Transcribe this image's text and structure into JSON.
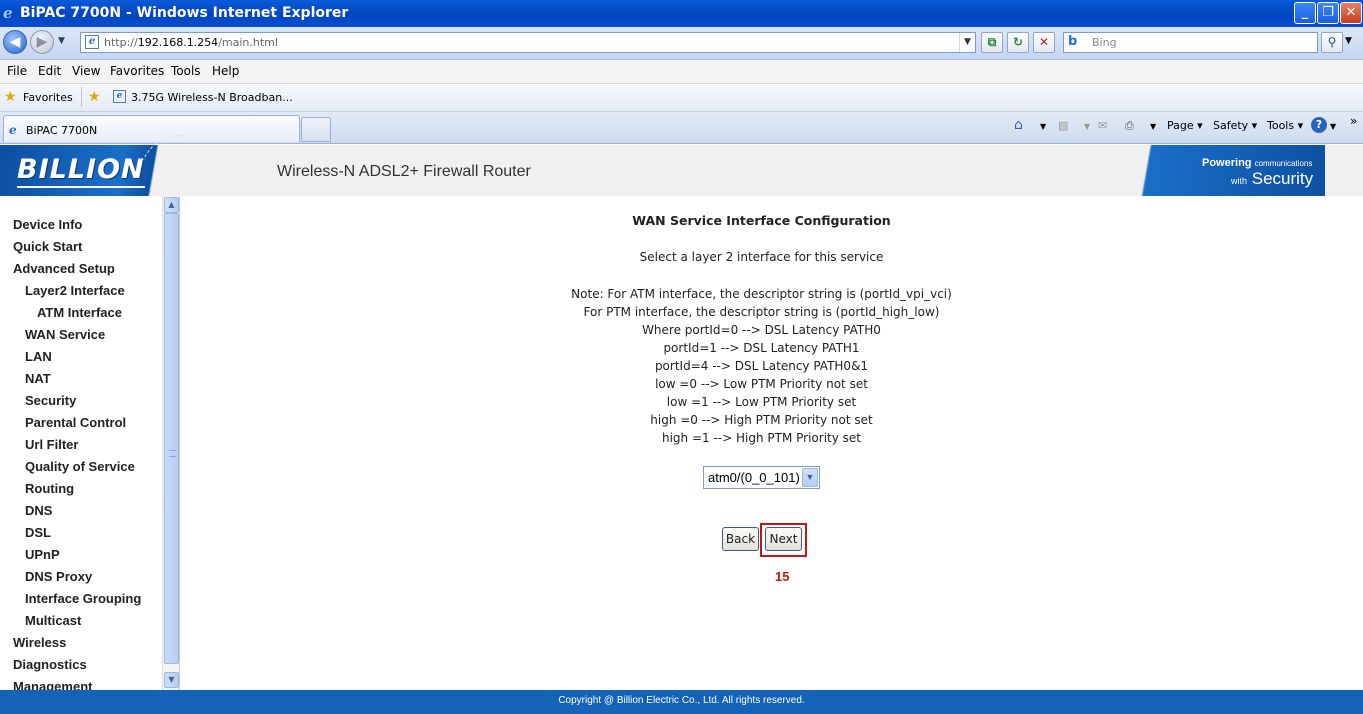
{
  "window": {
    "title": "BiPAC 7700N - Windows Internet Explorer",
    "controls": {
      "minimize": "_",
      "restore": "❐",
      "close": "✕"
    }
  },
  "address_bar": {
    "url_scheme": "http://",
    "url_host": "192.168.1.254",
    "url_path": "/main.html",
    "search_placeholder": "Bing"
  },
  "menu": [
    "File",
    "Edit",
    "View",
    "Favorites",
    "Tools",
    "Help"
  ],
  "favorites_bar": {
    "label": "Favorites",
    "link": "3.75G Wireless-N Broadban..."
  },
  "tab": {
    "title": "BiPAC 7700N"
  },
  "command_bar": {
    "page": "Page",
    "safety": "Safety",
    "tools": "Tools"
  },
  "banner": {
    "logo": "BILLION",
    "product": "Wireless-N ADSL2+ Firewall Router",
    "tagline_top": "Powering",
    "tagline_small": "communications",
    "tagline_with": "with",
    "tagline_bottom": "Security"
  },
  "sidebar": {
    "items": [
      {
        "label": "Device Info",
        "level": 0
      },
      {
        "label": "Quick Start",
        "level": 0
      },
      {
        "label": "Advanced Setup",
        "level": 0
      },
      {
        "label": "Layer2 Interface",
        "level": 1
      },
      {
        "label": "ATM Interface",
        "level": 2
      },
      {
        "label": "WAN Service",
        "level": 1
      },
      {
        "label": "LAN",
        "level": 1
      },
      {
        "label": "NAT",
        "level": 1
      },
      {
        "label": "Security",
        "level": 1
      },
      {
        "label": "Parental Control",
        "level": 1
      },
      {
        "label": "Url Filter",
        "level": 1
      },
      {
        "label": "Quality of Service",
        "level": 1
      },
      {
        "label": "Routing",
        "level": 1
      },
      {
        "label": "DNS",
        "level": 1
      },
      {
        "label": "DSL",
        "level": 1
      },
      {
        "label": "UPnP",
        "level": 1
      },
      {
        "label": "DNS Proxy",
        "level": 1
      },
      {
        "label": "Interface Grouping",
        "level": 1
      },
      {
        "label": "Multicast",
        "level": 1
      },
      {
        "label": "Wireless",
        "level": 0
      },
      {
        "label": "Diagnostics",
        "level": 0
      },
      {
        "label": "Management",
        "level": 0
      }
    ]
  },
  "main": {
    "heading": "WAN Service Interface Configuration",
    "instruction": "Select a layer 2 interface for this service",
    "notes": [
      "Note: For ATM interface, the descriptor string is (portId_vpi_vci)",
      "For PTM interface, the descriptor string is (portId_high_low)",
      "Where portId=0 --> DSL Latency PATH0",
      "portId=1 --> DSL Latency PATH1",
      "portId=4 --> DSL Latency PATH0&1",
      "low =0 --> Low PTM Priority not set",
      "low =1 --> Low PTM Priority set",
      "high =0 --> High PTM Priority not set",
      "high =1 --> High PTM Priority set"
    ],
    "interface_select_value": "atm0/(0_0_101)",
    "back_label": "Back",
    "next_label": "Next",
    "step_number": "15"
  },
  "footer": "Copyright @ Billion Electric Co., Ltd. All rights reserved.",
  "colors": {
    "accent_blue": "#1563b8",
    "highlight_red": "#cc1111"
  }
}
